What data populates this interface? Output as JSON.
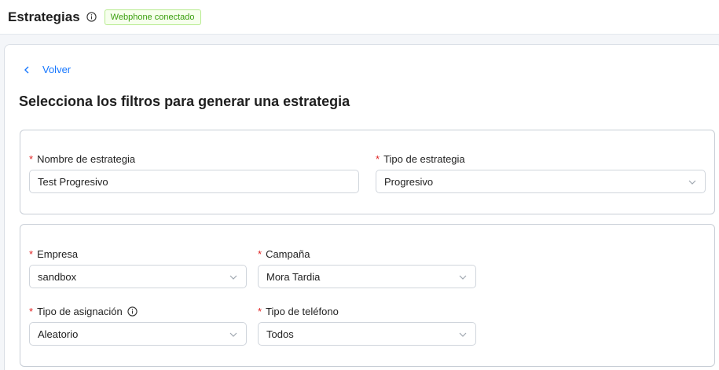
{
  "header": {
    "title": "Estrategias",
    "status_badge": "Webphone conectado"
  },
  "nav": {
    "back_label": "Volver"
  },
  "page": {
    "title": "Selecciona los filtros para generar una estrategia"
  },
  "fields": {
    "nombre": {
      "label": "Nombre de estrategia",
      "value": "Test Progresivo",
      "required": "*"
    },
    "tipo_estrategia": {
      "label": "Tipo de estrategia",
      "value": "Progresivo",
      "required": "*"
    },
    "empresa": {
      "label": "Empresa",
      "value": "sandbox",
      "required": "*"
    },
    "campana": {
      "label": "Campaña",
      "value": "Mora Tardia",
      "required": "*"
    },
    "tipo_asignacion": {
      "label": "Tipo de asignación",
      "value": "Aleatorio",
      "required": "*"
    },
    "tipo_telefono": {
      "label": "Tipo de teléfono",
      "value": "Todos",
      "required": "*"
    }
  },
  "colors": {
    "accent": "#1677ff",
    "success": "#389e0d",
    "required": "#e02424"
  },
  "icons": [
    "info-icon",
    "chevron-left-icon",
    "chevron-down-icon"
  ]
}
